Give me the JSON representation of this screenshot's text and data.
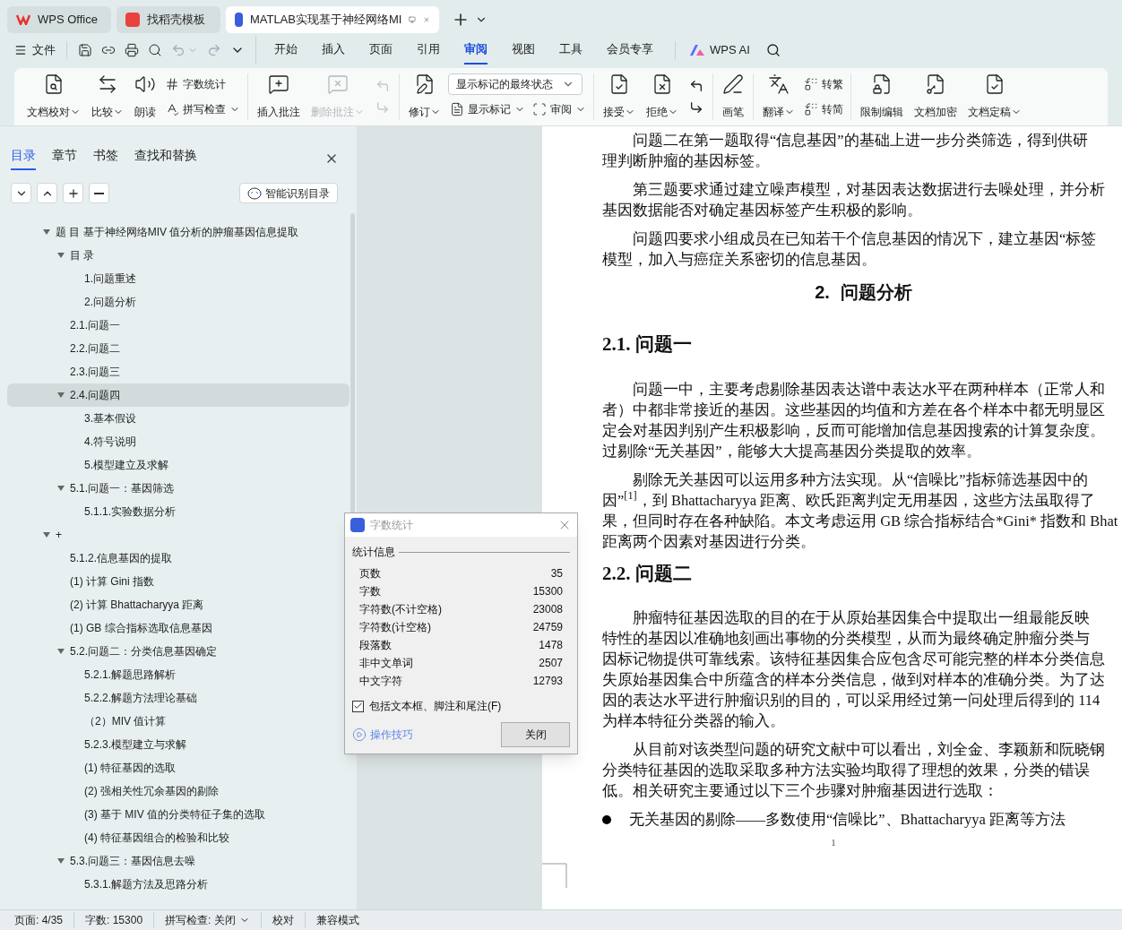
{
  "window_tabs": [
    {
      "label": "WPS Office",
      "selected": false
    },
    {
      "label": "找稻壳模板",
      "selected": false
    },
    {
      "label": "MATLAB实现基于神经网络MI",
      "selected": true
    }
  ],
  "menu": {
    "file": "文件",
    "tabs": [
      {
        "label": "开始",
        "selected": false
      },
      {
        "label": "插入",
        "selected": false
      },
      {
        "label": "页面",
        "selected": false
      },
      {
        "label": "引用",
        "selected": false
      },
      {
        "label": "审阅",
        "selected": true
      },
      {
        "label": "视图",
        "selected": false
      },
      {
        "label": "工具",
        "selected": false
      },
      {
        "label": "会员专享",
        "selected": false
      }
    ],
    "ai": "WPS AI"
  },
  "ribbon": [
    [
      {
        "kind": "large",
        "label": "文档校对",
        "caret": true,
        "disabled": false
      },
      {
        "kind": "large",
        "label": "比较",
        "caret": true,
        "disabled": false
      },
      {
        "kind": "large",
        "label": "朗读",
        "caret": false,
        "disabled": false
      },
      {
        "kind": "stack",
        "items": [
          {
            "label": "字数统计",
            "caret": false,
            "disabled": false
          },
          {
            "label": "拼写检查",
            "caret": true,
            "disabled": false
          }
        ]
      }
    ],
    [
      {
        "kind": "large",
        "label": "插入批注",
        "caret": false,
        "disabled": false
      },
      {
        "kind": "large",
        "label": "删除批注",
        "caret": true,
        "disabled": true
      },
      {
        "kind": "iconstack",
        "disabled": true
      }
    ],
    [
      {
        "kind": "large",
        "label": "修订",
        "caret": true,
        "disabled": false
      },
      {
        "kind": "markup",
        "value": "显示标记的最终状态",
        "items": [
          {
            "label": "显示标记",
            "caret": true,
            "disabled": false
          },
          {
            "label": "审阅",
            "caret": true,
            "disabled": false
          }
        ]
      }
    ],
    [
      {
        "kind": "large",
        "label": "接受",
        "caret": true,
        "disabled": false
      },
      {
        "kind": "large",
        "label": "拒绝",
        "caret": true,
        "disabled": false
      },
      {
        "kind": "iconstack",
        "disabled": false
      }
    ],
    [
      {
        "kind": "large",
        "label": "画笔",
        "caret": false,
        "disabled": false
      }
    ],
    [
      {
        "kind": "large",
        "label": "翻译",
        "caret": true,
        "disabled": false
      },
      {
        "kind": "stack",
        "items": [
          {
            "label": "转繁",
            "caret": false,
            "disabled": false
          },
          {
            "label": "转简",
            "caret": false,
            "disabled": false
          }
        ]
      }
    ],
    [
      {
        "kind": "large",
        "label": "限制编辑",
        "caret": false,
        "disabled": false
      },
      {
        "kind": "large",
        "label": "文档加密",
        "caret": false,
        "disabled": false
      },
      {
        "kind": "large",
        "label": "文档定稿",
        "caret": true,
        "disabled": false
      }
    ]
  ],
  "sidebar": {
    "tabs": [
      {
        "label": "目录",
        "selected": true
      },
      {
        "label": "章节",
        "selected": false
      },
      {
        "label": "书签",
        "selected": false
      },
      {
        "label": "查找和替换",
        "selected": false
      }
    ],
    "smart_button": "智能识别目录",
    "tree": [
      {
        "label": "题 目  基于神经网络MIV 值分析的肿瘤基因信息提取",
        "expanded": true,
        "selected": false,
        "children": [
          {
            "label": "目 录",
            "expanded": true,
            "selected": false,
            "children": [
              {
                "label": "1.问题重述",
                "selected": false
              },
              {
                "label": "2.问题分析",
                "selected": false
              }
            ]
          },
          {
            "label": "2.1.问题一",
            "selected": false
          },
          {
            "label": "2.2.问题二",
            "selected": false
          },
          {
            "label": "2.3.问题三",
            "selected": false
          },
          {
            "label": "2.4.问题四",
            "expanded": true,
            "selected": true,
            "children": [
              {
                "label": "3.基本假设",
                "selected": false
              },
              {
                "label": "4.符号说明",
                "selected": false
              },
              {
                "label": "5.模型建立及求解",
                "selected": false
              }
            ]
          },
          {
            "label": "5.1.问题一：基因筛选",
            "expanded": true,
            "selected": false,
            "children": [
              {
                "label": "5.1.1.实验数据分析",
                "selected": false
              }
            ]
          }
        ]
      },
      {
        "label": "+",
        "expanded": true,
        "selected": false,
        "children": [
          {
            "label": "5.1.2.信息基因的提取",
            "selected": false
          },
          {
            "label": "(1) 计算 Gini 指数",
            "selected": false
          },
          {
            "label": "(2) 计算 Bhattacharyya 距离",
            "selected": false
          },
          {
            "label": "(1) GB 综合指标选取信息基因",
            "selected": false
          },
          {
            "label": "5.2.问题二：分类信息基因确定",
            "expanded": true,
            "selected": false,
            "children": [
              {
                "label": "5.2.1.解题思路解析",
                "selected": false
              },
              {
                "label": "5.2.2.解题方法理论基础",
                "selected": false
              },
              {
                "label": "（2）MIV 值计算",
                "selected": false
              },
              {
                "label": "5.2.3.模型建立与求解",
                "selected": false
              },
              {
                "label": "(1) 特征基因的选取",
                "selected": false
              },
              {
                "label": "(2) 强相关性冗余基因的剔除",
                "selected": false
              },
              {
                "label": "(3) 基于 MIV 值的分类特征子集的选取",
                "selected": false
              },
              {
                "label": "(4) 特征基因组合的检验和比较",
                "selected": false
              }
            ]
          },
          {
            "label": "5.3.问题三：基因信息去噪",
            "expanded": true,
            "selected": false,
            "children": [
              {
                "label": "5.3.1.解题方法及思路分析",
                "selected": false
              }
            ]
          }
        ]
      }
    ]
  },
  "dialog": {
    "title": "字数统计",
    "section": "统计信息",
    "rows": [
      {
        "label": "页数",
        "value": "35"
      },
      {
        "label": "字数",
        "value": "15300"
      },
      {
        "label": "字符数(不计空格)",
        "value": "23008"
      },
      {
        "label": "字符数(计空格)",
        "value": "24759"
      },
      {
        "label": "段落数",
        "value": "1478"
      },
      {
        "label": "非中文单词",
        "value": "2507"
      },
      {
        "label": "中文字符",
        "value": "12793"
      }
    ],
    "checkbox": {
      "label": "包括文本框、脚注和尾注(F)",
      "checked": true
    },
    "tips_link": "操作技巧",
    "close_button": "关闭"
  },
  "document": {
    "blocks": [
      {
        "kind": "paragraph",
        "lines": [
          "问题二在第一题取得“信息基因”的基础上进一步分类筛选，得到供研",
          "理判断肿瘤的基因标签。"
        ]
      },
      {
        "kind": "paragraph",
        "lines": [
          "第三题要求通过建立噪声模型，对基因表达数据进行去噪处理，并分析",
          "基因数据能否对确定基因标签产生积极的影响。"
        ]
      },
      {
        "kind": "paragraph",
        "lines": [
          "问题四要求小组成员在已知若干个信息基因的情况下，建立基因“标签",
          "模型，加入与癌症关系密切的信息基因。"
        ]
      },
      {
        "kind": "chapter",
        "number": "2.",
        "text": "问题分析"
      },
      {
        "kind": "section",
        "text": "2.1. 问题一"
      },
      {
        "kind": "paragraph",
        "lines": [
          "问题一中，主要考虑剔除基因表达谱中表达水平在两种样本（正常人和",
          "者）中都非常接近的基因。这些基因的均值和方差在各个样本中都无明显区",
          "定会对基因判别产生积极影响，反而可能增加信息基因搜索的计算复杂度。",
          "过剔除“无关基因”，能够大大提高基因分类提取的效率。"
        ]
      },
      {
        "kind": "paragraph",
        "lines": [
          "剔除无关基因可以运用多种方法实现。从“信噪比”指标筛选基因中的",
          "因”$^{[1]}$，到 Bhattacharyya 距离、欧氏距离判定无用基因，这些方法虽取得了",
          "果，但同时存在各种缺陷。本文考虑运用 GB 综合指标结合*Gini* 指数和 Bhat",
          "距离两个因素对基因进行分类。"
        ]
      },
      {
        "kind": "section",
        "text": "2.2. 问题二"
      },
      {
        "kind": "paragraph",
        "lines": [
          "肿瘤特征基因选取的目的在于从原始基因集合中提取出一组最能反映",
          "特性的基因以准确地刻画出事物的分类模型，从而为最终确定肿瘤分类与",
          "因标记物提供可靠线索。该特征基因集合应包含尽可能完整的样本分类信息",
          "失原始基因集合中所蕴含的样本分类信息，做到对样本的准确分类。为了达",
          "因的表达水平进行肿瘤识别的目的，可以采用经过第一问处理后得到的 114",
          "为样本特征分类器的输入。"
        ]
      },
      {
        "kind": "paragraph",
        "lines": [
          "从目前对该类型问题的研究文献中可以看出，刘全金、李颖新和阮晓钢",
          "分类特征基因的选取采取多种方法实验均取得了理想的效果，分类的错误",
          "低。相关研究主要通过以下三个步骤对肿瘤基因进行选取："
        ]
      },
      {
        "kind": "bullet",
        "text": "无关基因的剔除——多数使用“信噪比”、Bhattacharyya 距离等方法"
      }
    ],
    "page_number": "1"
  },
  "status_bar": [
    {
      "kind": "text",
      "label": "页面: 4/35"
    },
    {
      "kind": "text",
      "label": "字数: 15300"
    },
    {
      "kind": "menu",
      "label": "拼写检查: 关闭"
    },
    {
      "kind": "button",
      "label": "校对"
    },
    {
      "kind": "text",
      "label": "兼容模式"
    }
  ]
}
